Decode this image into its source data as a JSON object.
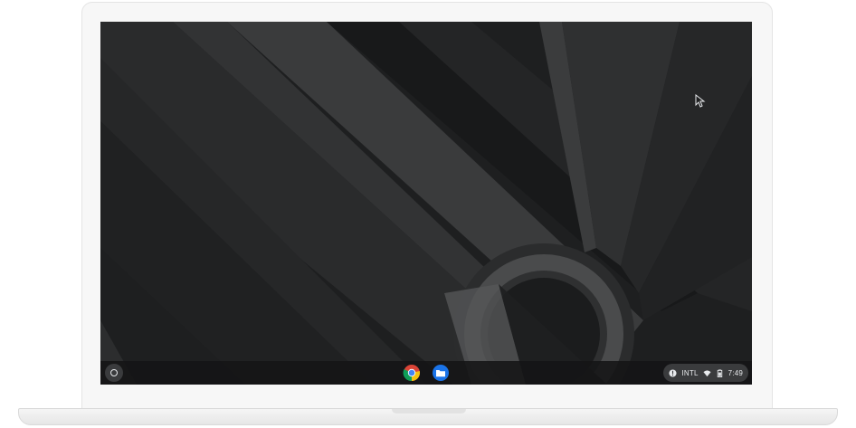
{
  "shelf": {
    "launcher_icon": "launcher-circle-icon",
    "apps": [
      {
        "name": "chrome",
        "icon": "chrome-icon"
      },
      {
        "name": "files",
        "icon": "files-folder-icon"
      }
    ]
  },
  "status_tray": {
    "notification_icon": "info-icon",
    "ime_label": "INTL",
    "wifi_icon": "wifi-icon",
    "battery_icon": "battery-icon",
    "time": "7:49"
  },
  "colors": {
    "wallpaper_base": "#1f2021",
    "shelf_bg": "#141516",
    "tray_bg": "#3a3b3d",
    "chrome_red": "#db4437",
    "chrome_yellow": "#f4c20d",
    "chrome_green": "#0f9d58",
    "chrome_blue": "#4285f4",
    "files_blue": "#1a73e8"
  }
}
